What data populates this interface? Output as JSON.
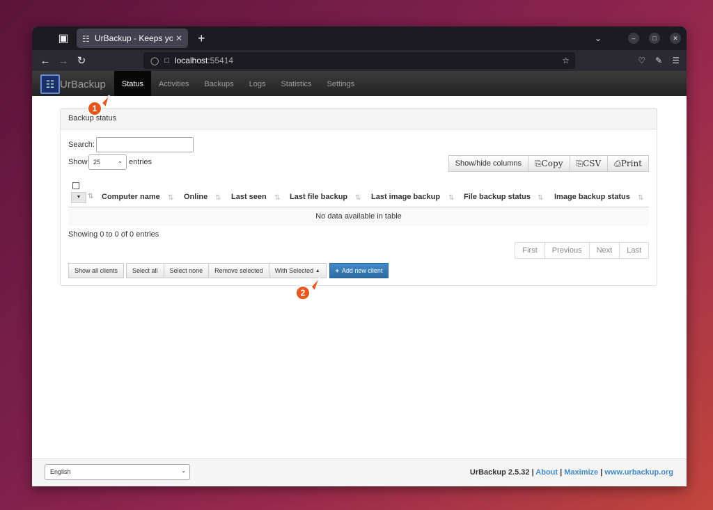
{
  "browser": {
    "tab_title": "UrBackup - Keeps your d",
    "url_host": "localhost",
    "url_port": ":55414"
  },
  "app": {
    "brand": "UrBackup",
    "nav": [
      "Status",
      "Activities",
      "Backups",
      "Logs",
      "Statistics",
      "Settings"
    ],
    "active_nav": "Status"
  },
  "panel": {
    "title": "Backup status",
    "search_label": "Search:",
    "show_label": "Show",
    "entries_value": "25",
    "entries_label": "entries",
    "buttons": {
      "show_hide": "Show/hide columns",
      "copy": "Copy",
      "csv": "CSV",
      "print": "Print"
    },
    "columns": [
      "Computer name",
      "Online",
      "Last seen",
      "Last file backup",
      "Last image backup",
      "File backup status",
      "Image backup status"
    ],
    "empty_message": "No data available in table",
    "info": "Showing 0 to 0 of 0 entries",
    "paging": [
      "First",
      "Previous",
      "Next",
      "Last"
    ],
    "actions": {
      "show_all": "Show all clients",
      "select_all": "Select all",
      "select_none": "Select none",
      "remove_selected": "Remove selected",
      "with_selected": "With Selected",
      "add_client": "Add new client"
    }
  },
  "markers": [
    "1",
    "2"
  ],
  "footer": {
    "language": "English",
    "version": "UrBackup 2.5.32",
    "sep": "|",
    "about": "About",
    "maximize": "Maximize",
    "site": "www.urbackup.org"
  },
  "colors": {
    "primary": "#428bca",
    "marker": "#e8581e",
    "navbar": "#222222"
  }
}
